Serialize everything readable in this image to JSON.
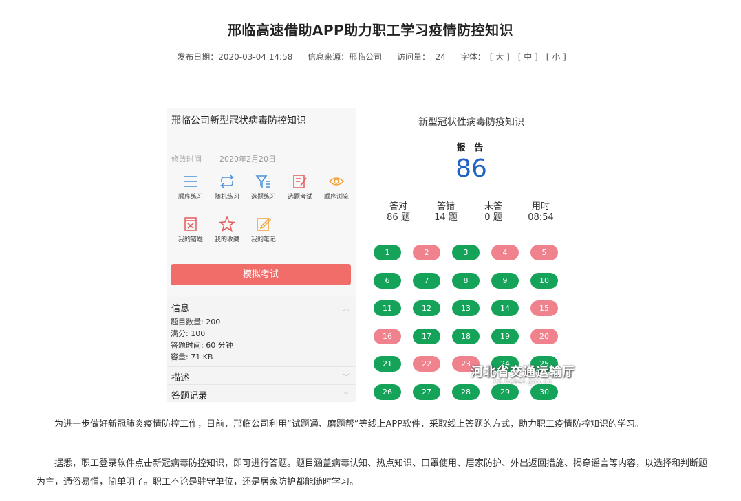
{
  "article": {
    "title": "邢临高速借助APP助力职工学习疫情防控知识",
    "publish_date": "发布日期：2020-03-04 14:58",
    "source": "信息来源：邢临公司",
    "visits_label": "访问量：",
    "visits_count": "24",
    "font_label": "字体：",
    "font_large": "[ 大 ]",
    "font_medium": "[ 中 ]",
    "font_small": "[ 小 ]"
  },
  "phone_left": {
    "title": "邢临公司新型冠状病毒防控知识",
    "modified_label": "修改时间",
    "modified_date": "2020年2月20日",
    "actions": [
      {
        "label": "顺序练习",
        "icon": "list-icon"
      },
      {
        "label": "随机练习",
        "icon": "shuffle-icon"
      },
      {
        "label": "选题练习",
        "icon": "filter-icon"
      },
      {
        "label": "选题考试",
        "icon": "edit-doc-icon"
      },
      {
        "label": "顺序浏览",
        "icon": "eye-icon"
      },
      {
        "label": "我的错题",
        "icon": "wrong-icon"
      },
      {
        "label": "我的收藏",
        "icon": "star-icon"
      },
      {
        "label": "我的笔记",
        "icon": "note-icon"
      }
    ],
    "exam_button": "模拟考试",
    "info_header": "信息",
    "info_lines": [
      "题目数量: 200",
      "满分: 100",
      "答题时间: 60 分钟",
      "容量: 71 KB"
    ],
    "desc_header": "描述",
    "records_header": "答题记录",
    "colors": {
      "icon_blue": "#4a90d9",
      "icon_red": "#e45b5b",
      "icon_orange": "#f0a030",
      "button_red": "#f06d6a"
    }
  },
  "phone_right": {
    "title": "新型冠状性病毒防疫知识",
    "report_label": "报 告",
    "score": "86",
    "stats": [
      {
        "label": "答对",
        "value": "86 题"
      },
      {
        "label": "答错",
        "value": "14 题"
      },
      {
        "label": "未答",
        "value": "0 题"
      },
      {
        "label": "用时",
        "value": "08:54"
      }
    ],
    "answers": [
      {
        "n": "1",
        "ok": true
      },
      {
        "n": "2",
        "ok": false
      },
      {
        "n": "3",
        "ok": true
      },
      {
        "n": "4",
        "ok": false
      },
      {
        "n": "5",
        "ok": false
      },
      {
        "n": "6",
        "ok": true
      },
      {
        "n": "7",
        "ok": true
      },
      {
        "n": "8",
        "ok": true
      },
      {
        "n": "9",
        "ok": true
      },
      {
        "n": "10",
        "ok": true
      },
      {
        "n": "11",
        "ok": true
      },
      {
        "n": "12",
        "ok": true
      },
      {
        "n": "13",
        "ok": true
      },
      {
        "n": "14",
        "ok": true
      },
      {
        "n": "15",
        "ok": false
      },
      {
        "n": "16",
        "ok": false
      },
      {
        "n": "17",
        "ok": true
      },
      {
        "n": "18",
        "ok": true
      },
      {
        "n": "19",
        "ok": true
      },
      {
        "n": "20",
        "ok": false
      },
      {
        "n": "21",
        "ok": true
      },
      {
        "n": "22",
        "ok": false
      },
      {
        "n": "23",
        "ok": false
      },
      {
        "n": "24",
        "ok": true
      },
      {
        "n": "25",
        "ok": true
      },
      {
        "n": "26",
        "ok": true
      },
      {
        "n": "27",
        "ok": true
      },
      {
        "n": "28",
        "ok": true
      },
      {
        "n": "29",
        "ok": true
      },
      {
        "n": "30",
        "ok": true
      }
    ],
    "watermark": "河北省交通运输厅",
    "watermark_url": "jtt.hebei.gov.cn",
    "colors": {
      "correct": "#15a35a",
      "wrong": "#f0828e",
      "score": "#1f63c6"
    }
  },
  "body": {
    "paragraph1": "为进一步做好新冠肺炎疫情防控工作，日前，邢临公司利用“试题通、磨题帮”等线上APP软件，采取线上答题的方式，助力职工疫情防控知识的学习。",
    "paragraph2": "据悉，职工登录软件点击新冠病毒防控知识，即可进行答题。题目涵盖病毒认知、热点知识、口罩使用、居家防护、外出返回措施、揭穿谣言等内容，以选择和判断题为主，通俗易懂，简单明了。职工不论是驻守单位，还是居家防护都能随时学习。"
  }
}
